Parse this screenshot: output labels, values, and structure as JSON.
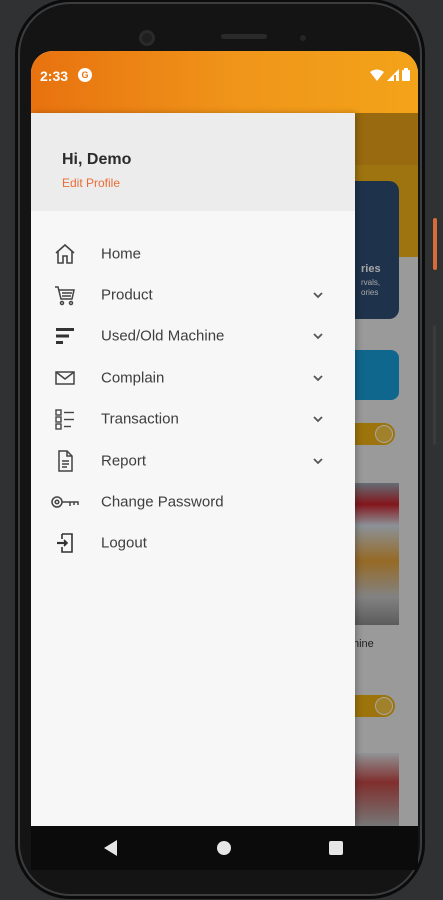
{
  "status_bar": {
    "time": "2:33",
    "app_badge": "G"
  },
  "drawer": {
    "greeting": "Hi, Demo",
    "edit_profile": "Edit Profile",
    "items": [
      {
        "label": "Home",
        "icon": "home-icon",
        "expandable": false
      },
      {
        "label": "Product",
        "icon": "cart-icon",
        "expandable": true
      },
      {
        "label": "Used/Old Machine",
        "icon": "sort-icon",
        "expandable": true
      },
      {
        "label": "Complain",
        "icon": "mail-icon",
        "expandable": true
      },
      {
        "label": "Transaction",
        "icon": "checklist-icon",
        "expandable": true
      },
      {
        "label": "Report",
        "icon": "document-icon",
        "expandable": true
      },
      {
        "label": "Change Password",
        "icon": "key-icon",
        "expandable": false
      },
      {
        "label": "Logout",
        "icon": "logout-icon",
        "expandable": false
      }
    ]
  },
  "background_app": {
    "card_title": "ries",
    "card_line1": "rvals,",
    "card_line2": "ories",
    "product_text": "hine"
  },
  "colors": {
    "accent_orange": "#ea6b34",
    "status_gradient_start": "#e8720f",
    "status_gradient_end": "#f3a319"
  }
}
